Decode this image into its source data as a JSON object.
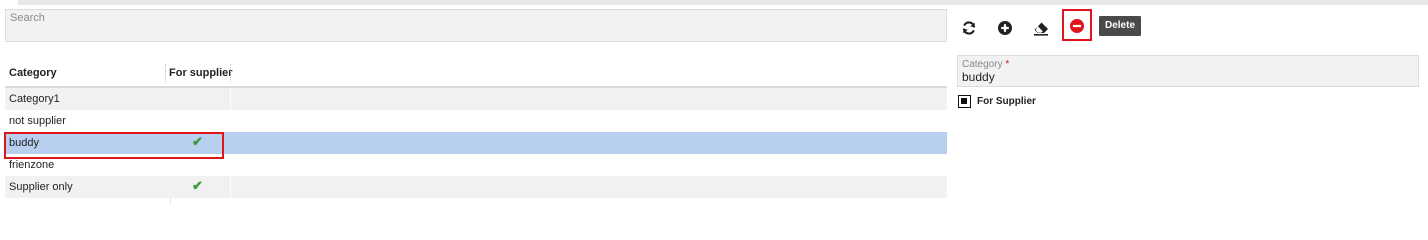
{
  "search": {
    "placeholder": "Search"
  },
  "grid": {
    "columns": [
      "Category",
      "For supplier"
    ],
    "rows": [
      {
        "category": "Category1",
        "for_supplier": false,
        "check": ""
      },
      {
        "category": "not supplier",
        "for_supplier": false,
        "check": ""
      },
      {
        "category": "buddy",
        "for_supplier": true,
        "check": "✔",
        "selected": true
      },
      {
        "category": "frienzone",
        "for_supplier": false,
        "check": ""
      },
      {
        "category": "Supplier only",
        "for_supplier": true,
        "check": "✔"
      }
    ]
  },
  "toolbar": {
    "buttons": [
      {
        "name": "refresh",
        "icon": "refresh-icon"
      },
      {
        "name": "add",
        "icon": "plus-circle-icon"
      },
      {
        "name": "clear",
        "icon": "eraser-icon"
      },
      {
        "name": "delete",
        "icon": "minus-circle-icon"
      }
    ],
    "tooltip": "Delete"
  },
  "form": {
    "category_label": "Category",
    "required_marker": "*",
    "category_value": "buddy",
    "supplier_label": "For Supplier",
    "supplier_checked": true
  },
  "colors": {
    "selected_row": "#b8cff0",
    "delete_red": "#e0141b",
    "check_green": "#3a9a3a",
    "tooltip_bg": "#4a4a4a"
  }
}
